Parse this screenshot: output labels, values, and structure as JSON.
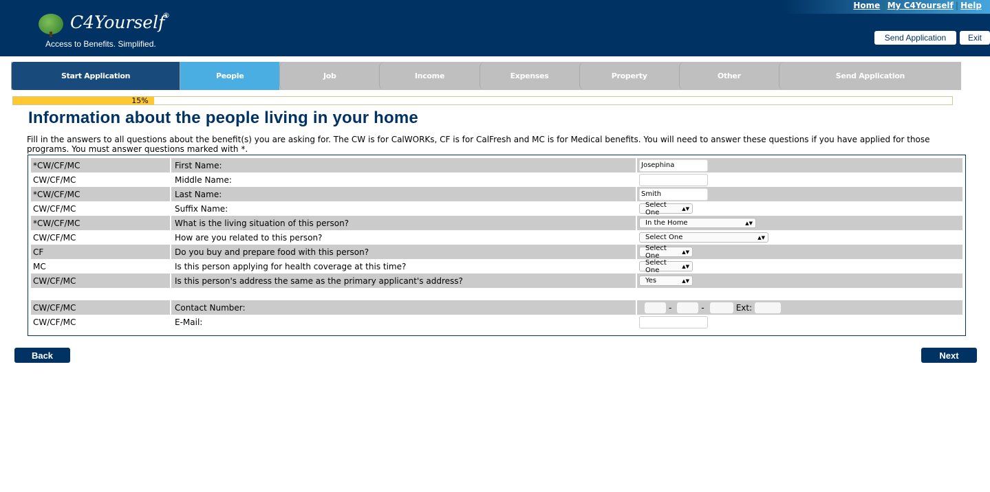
{
  "header": {
    "logo_text": "C4Yourself",
    "registered": "®",
    "tagline": "Access to Benefits.  Simplified.",
    "links": [
      "Home",
      "My C4Yourself",
      "Help"
    ],
    "send_application": "Send Application",
    "exit": "Exit"
  },
  "tabs": [
    {
      "label": "Start Application",
      "state": "done"
    },
    {
      "label": "People",
      "state": "active"
    },
    {
      "label": "Job"
    },
    {
      "label": "Income"
    },
    {
      "label": "Expenses"
    },
    {
      "label": "Property"
    },
    {
      "label": "Other"
    },
    {
      "label": "Send Application"
    }
  ],
  "progress": {
    "value": 15,
    "label": "15%"
  },
  "page_title": "Information about the people living in your home",
  "intro": "Fill in the answers to all questions about the benefit(s) you are asking for. The CW is for CalWORKs, CF is for CalFresh and MC is for Medical benefits. You will need to answer these questions if you have applied for those programs. You must answer questions marked with *.",
  "rows": [
    {
      "programs": "*CW/CF/MC",
      "question": "First Name:",
      "value": "Josephina"
    },
    {
      "programs": "CW/CF/MC",
      "question": "Middle Name:",
      "value": ""
    },
    {
      "programs": "*CW/CF/MC",
      "question": "Last Name:",
      "value": "Smith"
    },
    {
      "programs": "CW/CF/MC",
      "question": "Suffix Name:",
      "value": "Select One"
    },
    {
      "programs": "*CW/CF/MC",
      "question": "What is the living situation of this person?",
      "value": "In the Home"
    },
    {
      "programs": "CW/CF/MC",
      "question": "How are you related to this person?",
      "value": "Select One"
    },
    {
      "programs": "CF",
      "question": "Do you buy and prepare food with this person?",
      "value": "Select One"
    },
    {
      "programs": "MC",
      "question": "Is this person applying for health coverage at this time?",
      "value": "Select One"
    },
    {
      "programs": "CW/CF/MC",
      "question": "Is this person's address the same as the primary applicant's address?",
      "value": "Yes"
    },
    {
      "programs": "CW/CF/MC",
      "question": "Contact Number:",
      "dash": "-",
      "ext": "Ext:"
    },
    {
      "programs": "CW/CF/MC",
      "question": "E-Mail:",
      "value": ""
    }
  ],
  "buttons": {
    "back": "Back",
    "next": "Next"
  },
  "colors": {
    "brand": "#003263",
    "active_tab": "#4aaee2",
    "progress": "#fec831"
  }
}
